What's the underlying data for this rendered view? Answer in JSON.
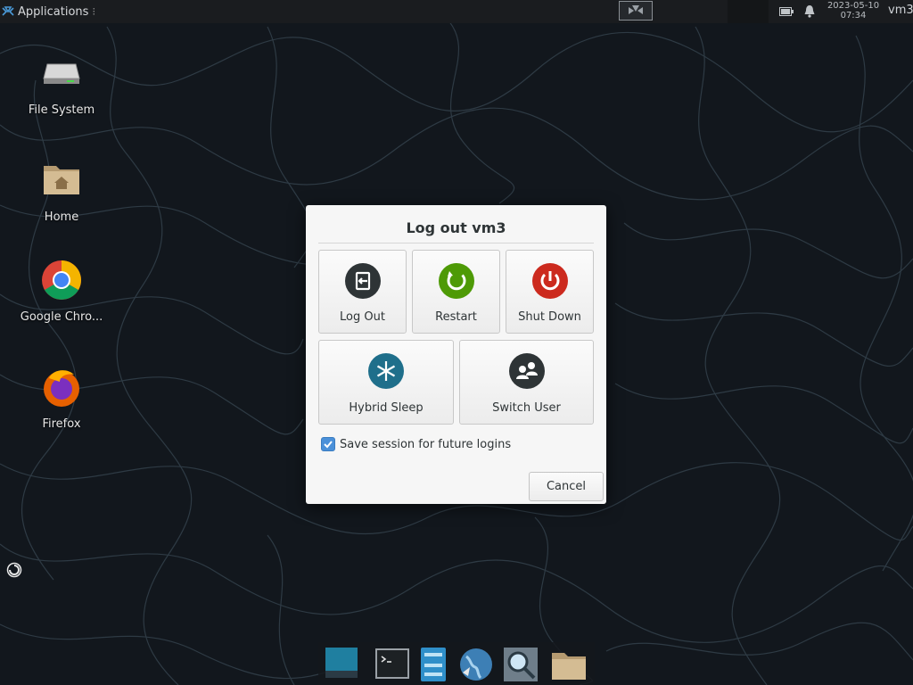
{
  "panel": {
    "applications_label": "Applications",
    "date": "2023-05-10",
    "time": "07:34",
    "user": "vm3"
  },
  "desktop": {
    "icons": [
      {
        "label": "File System"
      },
      {
        "label": "Home"
      },
      {
        "label": "Google Chro..."
      },
      {
        "label": "Firefox"
      }
    ]
  },
  "dialog": {
    "title": "Log out vm3",
    "actions": [
      {
        "label": "Log Out",
        "icon": "logout-icon",
        "color": "#2e3436"
      },
      {
        "label": "Restart",
        "icon": "restart-icon",
        "color": "#4e9a06"
      },
      {
        "label": "Shut Down",
        "icon": "power-icon",
        "color": "#cc2a1e"
      },
      {
        "label": "Hybrid Sleep",
        "icon": "snowflake-icon",
        "color": "#1f6f8b"
      },
      {
        "label": "Switch User",
        "icon": "users-icon",
        "color": "#2e3436"
      }
    ],
    "save_session_label": "Save session for future logins",
    "save_session_checked": true,
    "cancel_label": "Cancel"
  },
  "dock": {
    "items": [
      "show-desktop-icon",
      "terminal-icon",
      "file-manager-icon",
      "web-browser-icon",
      "search-icon",
      "folder-icon"
    ]
  }
}
